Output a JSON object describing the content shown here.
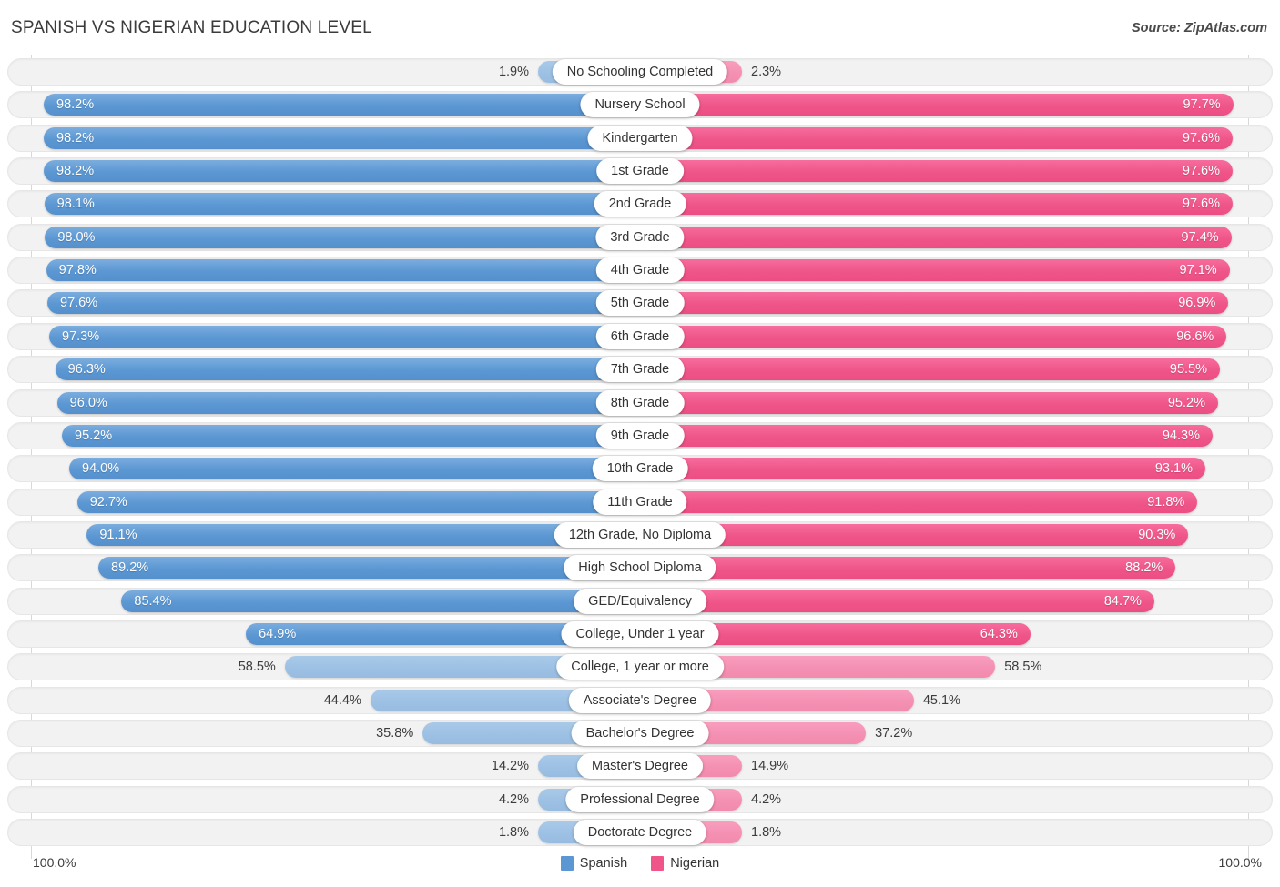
{
  "header": {
    "title": "SPANISH VS NIGERIAN EDUCATION LEVEL",
    "source": "Source: ZipAtlas.com"
  },
  "legend": {
    "items": [
      {
        "label": "Spanish",
        "color": "#5b97d3"
      },
      {
        "label": "Nigerian",
        "color": "#ef5589"
      }
    ]
  },
  "axis": {
    "left_end": "100.0%",
    "right_end": "100.0%",
    "max": 100.0
  },
  "chart_data": {
    "type": "bar",
    "orientation": "horizontal-diverging",
    "title": "SPANISH VS NIGERIAN EDUCATION LEVEL",
    "xlabel": "",
    "ylabel": "",
    "xlim": [
      0,
      100
    ],
    "grid": false,
    "legend_position": "bottom-center",
    "categories": [
      "No Schooling Completed",
      "Nursery School",
      "Kindergarten",
      "1st Grade",
      "2nd Grade",
      "3rd Grade",
      "4th Grade",
      "5th Grade",
      "6th Grade",
      "7th Grade",
      "8th Grade",
      "9th Grade",
      "10th Grade",
      "11th Grade",
      "12th Grade, No Diploma",
      "High School Diploma",
      "GED/Equivalency",
      "College, Under 1 year",
      "College, 1 year or more",
      "Associate's Degree",
      "Bachelor's Degree",
      "Master's Degree",
      "Professional Degree",
      "Doctorate Degree"
    ],
    "series": [
      {
        "name": "Spanish",
        "color": "#5b97d3",
        "values": [
          1.9,
          98.2,
          98.2,
          98.2,
          98.1,
          98.0,
          97.8,
          97.6,
          97.3,
          96.3,
          96.0,
          95.2,
          94.0,
          92.7,
          91.1,
          89.2,
          85.4,
          64.9,
          58.5,
          44.4,
          35.8,
          14.2,
          4.2,
          1.8
        ],
        "labels": [
          "1.9%",
          "98.2%",
          "98.2%",
          "98.2%",
          "98.1%",
          "98.0%",
          "97.8%",
          "97.6%",
          "97.3%",
          "96.3%",
          "96.0%",
          "95.2%",
          "94.0%",
          "92.7%",
          "91.1%",
          "89.2%",
          "85.4%",
          "64.9%",
          "58.5%",
          "44.4%",
          "35.8%",
          "14.2%",
          "4.2%",
          "1.8%"
        ]
      },
      {
        "name": "Nigerian",
        "color": "#ef5589",
        "values": [
          2.3,
          97.7,
          97.6,
          97.6,
          97.6,
          97.4,
          97.1,
          96.9,
          96.6,
          95.5,
          95.2,
          94.3,
          93.1,
          91.8,
          90.3,
          88.2,
          84.7,
          64.3,
          58.5,
          45.1,
          37.2,
          14.9,
          4.2,
          1.8
        ],
        "labels": [
          "2.3%",
          "97.7%",
          "97.6%",
          "97.6%",
          "97.6%",
          "97.4%",
          "97.1%",
          "96.9%",
          "96.6%",
          "95.5%",
          "95.2%",
          "94.3%",
          "93.1%",
          "91.8%",
          "90.3%",
          "88.2%",
          "84.7%",
          "64.3%",
          "58.5%",
          "45.1%",
          "37.2%",
          "14.9%",
          "4.2%",
          "1.8%"
        ]
      }
    ]
  }
}
